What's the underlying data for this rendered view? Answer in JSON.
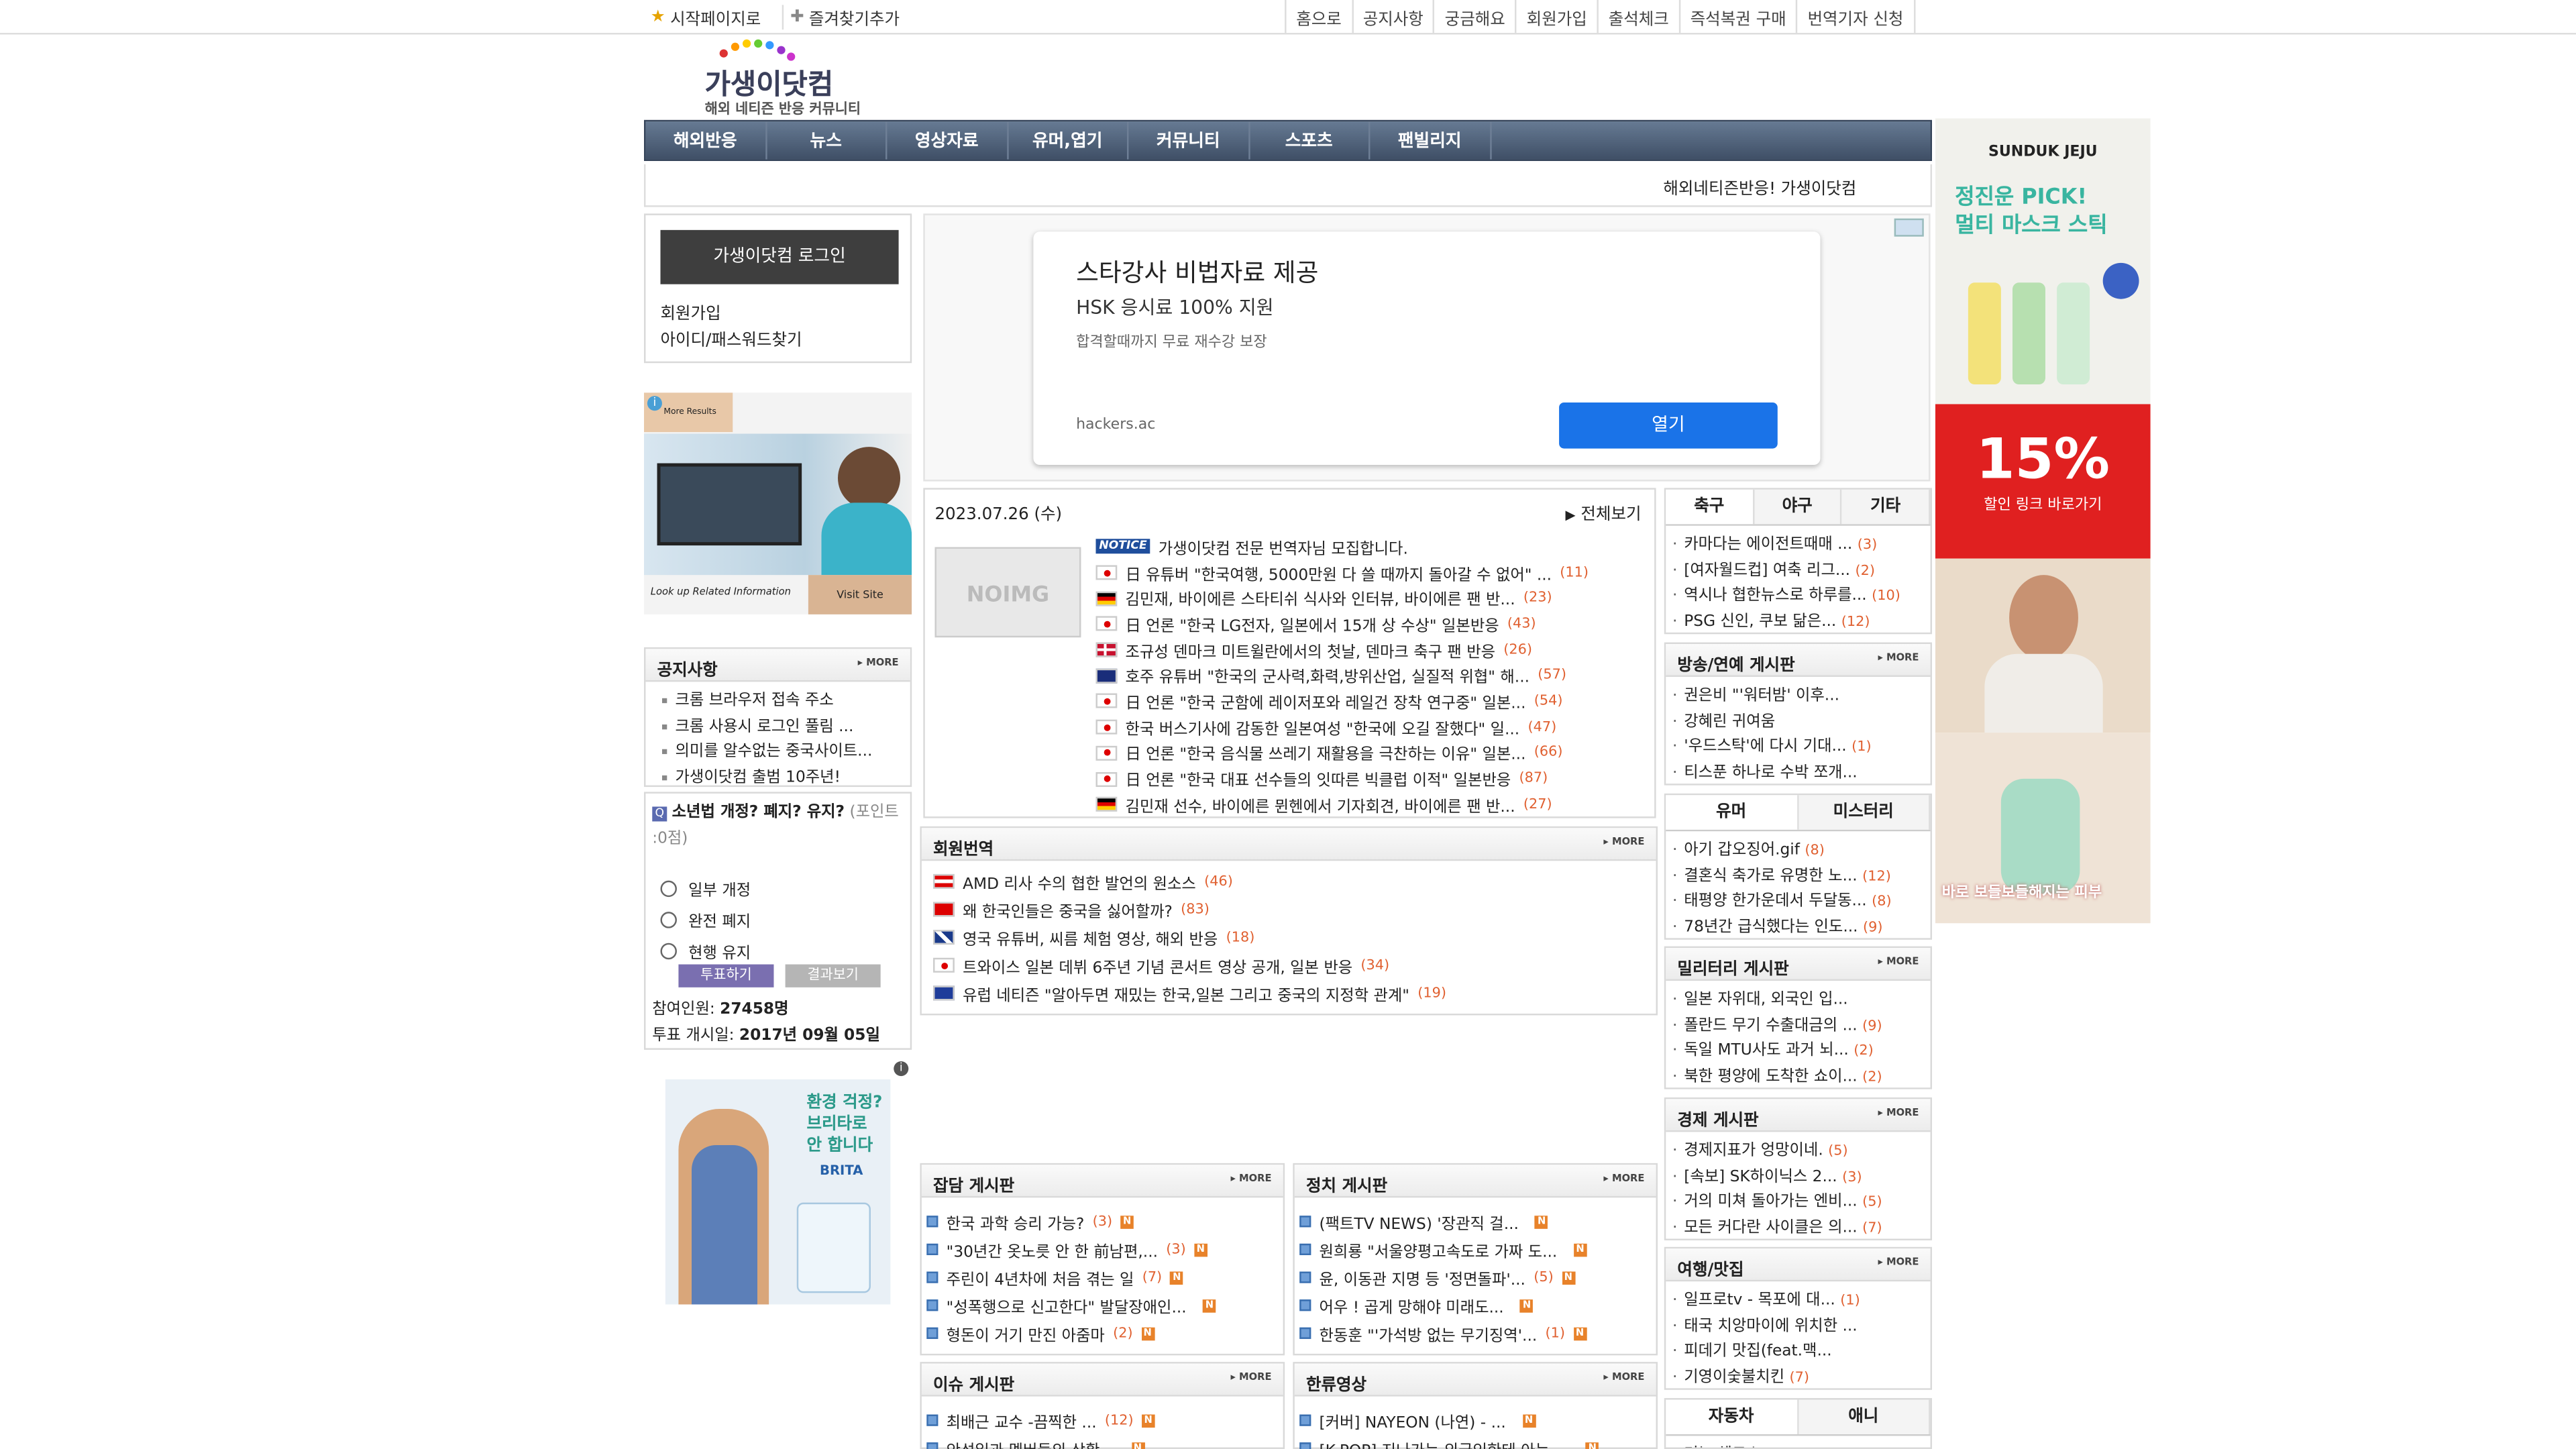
{
  "topbar": {
    "start_page": "시작페이지로",
    "bookmark": "즐겨찾기추가",
    "links": [
      "홈으로",
      "공지사항",
      "궁금해요",
      "회원가입",
      "출석체크",
      "즉석복권 구매",
      "번역기자 신청"
    ]
  },
  "logo": {
    "title": "가생이닷컴",
    "subtitle": "해외 네티즌 반응 커뮤니티"
  },
  "mainnav": [
    "해외반응",
    "뉴스",
    "영상자료",
    "유머,엽기",
    "커뮤니티",
    "스포츠",
    "팬빌리지"
  ],
  "tagline": "해외네티즌반응! 가생이닷컴",
  "login": {
    "button": "가생이닷컴 로그인",
    "join": "회원가입",
    "find": "아이디/패스워드찾기"
  },
  "left_ad": {
    "top": "More Results",
    "caption": "Look up Related Information",
    "button": "Visit Site"
  },
  "notice": {
    "title": "공지사항",
    "more": "MORE",
    "items": [
      "크롬 브라우저 접속 주소",
      "크롬 사용시 로그인 풀림 ...",
      "의미를 알수없는 중국사이트...",
      "가생이닷컴 출범 10주년!"
    ]
  },
  "poll": {
    "question": "소년법 개정? 폐지? 유지?",
    "points": "(포인트 :0점)",
    "options": [
      "일부 개정",
      "완전 폐지",
      "현행 유지"
    ],
    "vote": "투표하기",
    "result": "결과보기",
    "participants_label": "참여인원:",
    "participants": "27458명",
    "start_label": "투표 개시일:",
    "start": "2017년 09월 05일"
  },
  "brita_ad": {
    "line1": "환경 걱정?",
    "line2": "브리타로",
    "line3": "안 합니다",
    "brand": "BRITA"
  },
  "big_ad": {
    "headline": "스타강사 비법자료 제공",
    "sub": "HSK 응시료 100% 지원",
    "desc": "합격할때까지 무료 재수강 보장",
    "url": "hackers.ac",
    "open": "열기"
  },
  "news": {
    "date": "2023.07.26 (수)",
    "all": "전체보기",
    "noimg": "NOIMG",
    "notice_tag": "NOTICE",
    "notice": "가생이닷컴 전문 번역자님 모집합니다.",
    "items": [
      {
        "flag": "jp",
        "title": "日 유튜버 \"한국여행, 5000만원 다 쓸 때까지 돌아갈 수 없어\" ...",
        "count": "(11)"
      },
      {
        "flag": "de",
        "title": "김민재, 바이에른 스타티쉬 식사와 인터뷰, 바이에른 팬 반...",
        "count": "(23)"
      },
      {
        "flag": "jp",
        "title": "日 언론 \"한국 LG전자, 일본에서 15개 상 수상\" 일본반응",
        "count": "(43)"
      },
      {
        "flag": "dk",
        "title": "조규성 덴마크 미트윌란에서의 첫날, 덴마크 축구 팬 반응",
        "count": "(26)"
      },
      {
        "flag": "au",
        "title": "호주 유튜버 \"한국의 군사력,화력,방위산업, 실질적 위협\" 해...",
        "count": "(57)"
      },
      {
        "flag": "jp",
        "title": "日 언론 \"한국 군함에 레이저포와 레일건 장착 연구중\" 일본...",
        "count": "(54)"
      },
      {
        "flag": "jp",
        "title": "한국 버스기사에 감동한 일본여성 \"한국에 오길 잘했다\" 일...",
        "count": "(47)"
      },
      {
        "flag": "jp",
        "title": "日 언론 \"한국 음식물 쓰레기 재활용을 극찬하는 이유\" 일본...",
        "count": "(66)"
      },
      {
        "flag": "jp",
        "title": "日 언론 \"한국 대표 선수들의 잇따른 빅클럽 이적\" 일본반응",
        "count": "(87)"
      },
      {
        "flag": "de",
        "title": "김민재 선수, 바이에른 뮌헨에서 기자회견, 바이에른 팬 반...",
        "count": "(27)"
      }
    ]
  },
  "translation": {
    "title": "회원번역",
    "more": "MORE",
    "items": [
      {
        "flag": "at",
        "title": "AMD 리사 수의 협한 발언의 원소스",
        "count": "(46)"
      },
      {
        "flag": "cn",
        "title": "왜 한국인들은 중국을 싫어할까?",
        "count": "(83)"
      },
      {
        "flag": "gb",
        "title": "영국 유튜버, 씨름 체험 영상, 해외 반응",
        "count": "(18)"
      },
      {
        "flag": "jp",
        "title": "트와이스 일본 데뷔 6주년 기념 콘서트 영상 공개, 일본 반응",
        "count": "(34)"
      },
      {
        "flag": "eu",
        "title": "유럽 네티즌 \"알아두면 재밌는 한국,일본 그리고 중국의 지정학 관계\"",
        "count": "(19)"
      }
    ]
  },
  "boards": {
    "chat": {
      "title": "잡담 게시판",
      "more": "MORE",
      "items": [
        {
          "t": "한국 과학 승리 가능?",
          "c": "(3)"
        },
        {
          "t": "\"30년간 옷노릇 안 한 前남편,...",
          "c": "(3)"
        },
        {
          "t": "주린이 4년차에 처음 겪는 일",
          "c": "(7)"
        },
        {
          "t": "\"성폭행으로 신고한다\" 발달장애인...",
          "c": ""
        },
        {
          "t": "형돈이 거기 만진 아줌마",
          "c": "(2)"
        }
      ]
    },
    "politics": {
      "title": "정치 게시판",
      "more": "MORE",
      "items": [
        {
          "t": "(팩트TV NEWS) '장관직 걸...",
          "c": ""
        },
        {
          "t": "원희룡 \"서울양평고속도로 가짜 도...",
          "c": ""
        },
        {
          "t": "윤, 이동관 지명 등 '정면돌파'...",
          "c": "(5)"
        },
        {
          "t": "어우 ! 곱게 망해야 미래도...",
          "c": ""
        },
        {
          "t": "한동훈 \"'가석방 없는 무기징역'...",
          "c": "(1)"
        }
      ]
    },
    "issue": {
      "title": "이슈 게시판",
      "more": "MORE",
      "items": [
        {
          "t": "최배근 교수 -끔찍한 ...",
          "c": "(12)"
        },
        {
          "t": "안성일과 멤버들의 상황...",
          "c": ""
        }
      ]
    },
    "hallyu": {
      "title": "한류영상",
      "more": "MORE",
      "items": [
        {
          "t": "[커버] NAYEON (나연) - ...",
          "c": ""
        },
        {
          "t": "[K-POP] 지나가는 외국인한테 아는 ...",
          "c": ""
        }
      ]
    }
  },
  "right": {
    "sports_tabs": [
      "축구",
      "야구",
      "기타"
    ],
    "sports": [
      {
        "t": "카마다는 에이전트때매 ...",
        "c": "(3)"
      },
      {
        "t": "[여자월드컵] 여축 리그...",
        "c": "(2)"
      },
      {
        "t": "역시나 협한뉴스로 하루를...",
        "c": "(10)"
      },
      {
        "t": "PSG 신인, 쿠보 닮은...",
        "c": "(12)"
      }
    ],
    "ent": {
      "title": "방송/연예 게시판",
      "items": [
        {
          "t": "권은비 \"'워터밤' 이후...",
          "c": ""
        },
        {
          "t": "강혜린 귀여움",
          "c": ""
        },
        {
          "t": "'우드스탁'에 다시 기대...",
          "c": "(1)"
        },
        {
          "t": "티스푼 하나로 수박 쪼개...",
          "c": ""
        }
      ]
    },
    "humor_tabs": [
      "유머",
      "미스터리"
    ],
    "humor": [
      {
        "t": "아기 갑오징어.gif",
        "c": "(8)"
      },
      {
        "t": "결혼식 축가로 유명한 노...",
        "c": "(12)"
      },
      {
        "t": "태평양 한가운데서 두달동...",
        "c": "(8)"
      },
      {
        "t": "78년간 급식했다는 인도...",
        "c": "(9)"
      }
    ],
    "military": {
      "title": "밀리터리 게시판",
      "items": [
        {
          "t": "일본 자위대, 외국인 입...",
          "c": ""
        },
        {
          "t": "폴란드 무기 수출대금의 ...",
          "c": "(9)"
        },
        {
          "t": "독일 MTU사도 과거 뇌...",
          "c": "(2)"
        },
        {
          "t": "북한 평양에 도착한 쇼이...",
          "c": "(2)"
        }
      ]
    },
    "economy": {
      "title": "경제 게시판",
      "items": [
        {
          "t": "경제지표가 엉망이네.",
          "c": "(5)"
        },
        {
          "t": "[속보] SK하이닉스 2...",
          "c": "(3)"
        },
        {
          "t": "거의 미쳐 돌아가는 엔비...",
          "c": "(5)"
        },
        {
          "t": "모든 커다란 사이클은 의...",
          "c": "(7)"
        }
      ]
    },
    "travel": {
      "title": "여행/맛집",
      "items": [
        {
          "t": "일프로tv - 목포에 대...",
          "c": "(1)"
        },
        {
          "t": "태국 치앙마이에 위치한 ...",
          "c": ""
        },
        {
          "t": "피데기 맛집(feat.맥...",
          "c": ""
        },
        {
          "t": "기영이숯불치킨",
          "c": "(7)"
        }
      ]
    },
    "car_tabs": [
      "자동차",
      "애니"
    ],
    "car": [
      {
        "t": "더뉴 셀토스",
        "c": "(7)"
      }
    ]
  },
  "right_ad": {
    "brand": "SUNDUK JEJU",
    "headline": "정진운 PICK!\n멀티 마스크 스틱",
    "sale": "15%",
    "sale_sub": "할인 링크 바로가기",
    "caption": "바로 보들보들해지는 피부"
  }
}
